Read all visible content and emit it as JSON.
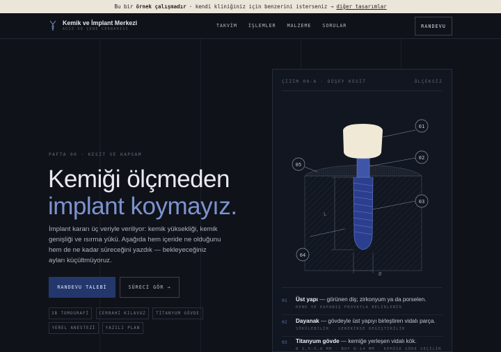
{
  "banner": {
    "prefix": "Bu bir",
    "bold": "örnek çalışmadır",
    "middle": "· kendi kliniğiniz için benzerini isterseniz →",
    "link": "diğer tasarımlar"
  },
  "brand": {
    "title": "Kemik ve İmplant Merkezi",
    "subtitle": "AĞIZ VE ÇENE CERRAHİSİ"
  },
  "nav": {
    "items": [
      "TAKVİM",
      "İŞLEMLER",
      "MALZEME",
      "SORULAR"
    ],
    "cta": "RANDEVU"
  },
  "hero": {
    "crumb": "PAFTA 00 · KESİT VE KAPSAM",
    "title_line1": "Kemiği ölçmeden",
    "title_line2": "implant koymayız.",
    "lead": "İmplant kararı üç veriyle veriliyor: kemik yüksekliği, kemik genişliği ve ısırma yükü. Aşağıda hem içeride ne olduğunu hem de ne kadar süreceğini yazdık — bekleyeceğiniz ayları küçültmüyoruz.",
    "primary_button": "RANDEVU TALEBİ",
    "secondary_button": "SÜRECİ GÖR →",
    "tags": [
      "3B TOMOGRAFİ",
      "CERRAHİ KILAVUZ",
      "TİTANYUM GÖVDE",
      "YEREL ANESTEZİ",
      "YAZILI PLAN"
    ]
  },
  "drawing": {
    "title": "ÇİZİM 00-A · DÜŞEY KESİT",
    "scale": "ÖLÇEKSİZ",
    "callouts": [
      "01",
      "02",
      "03",
      "04",
      "05"
    ],
    "dim_height": "L",
    "dim_width": "Ø",
    "colors": {
      "crown": "#efe9d6",
      "implant": "#2c3f8f",
      "bone": "#161b25",
      "accent": "#7d93cf"
    }
  },
  "legend": [
    {
      "num": "01",
      "bold": "Üst yapı",
      "text": " — görünen diş; zirkonyum ya da porselen.",
      "sub": "RENK VE KAPANIŞ PROVAYLA BELİRLENİR"
    },
    {
      "num": "02",
      "bold": "Dayanak",
      "text": " — gövdeyle üst yapıyı birleştiren vidalı parça.",
      "sub": "SÖKÜLEBİLİR · GEREKİRSE DEĞİŞTİRİLİR"
    },
    {
      "num": "03",
      "bold": "Titanyum gövde",
      "text": " — kemiğe yerleşen vidalı kök.",
      "sub": "Ø 3,5–5,0 MM · BOY 8–14 MM · KEMİĞE GÖRE SEÇİLİR"
    }
  ]
}
